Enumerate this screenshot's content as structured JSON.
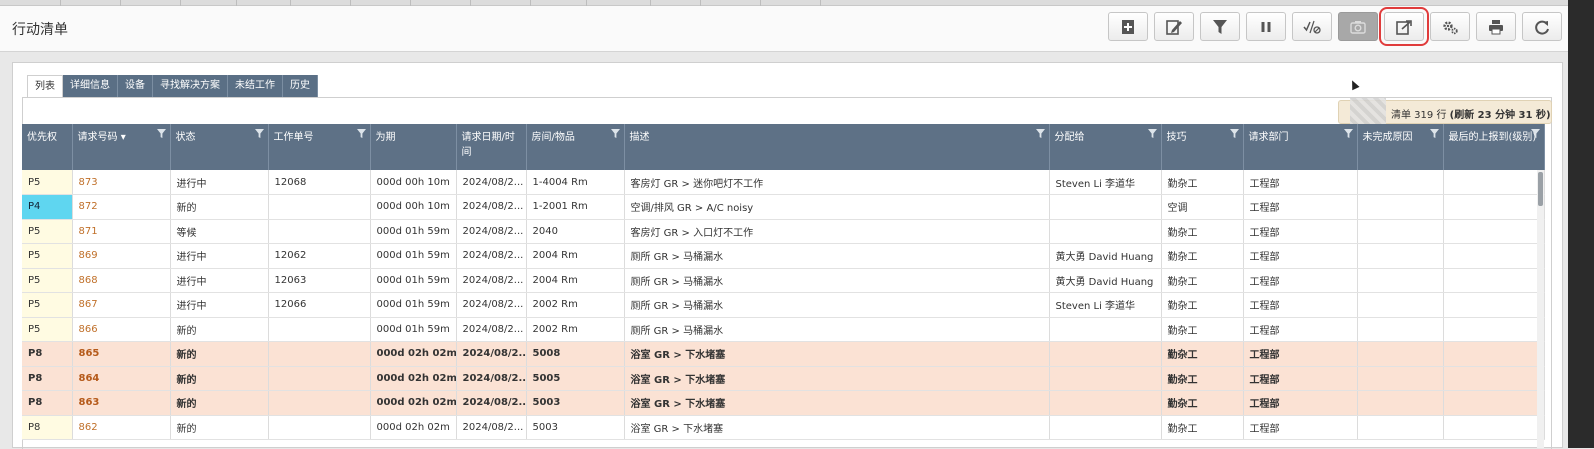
{
  "page": {
    "title": "行动清单"
  },
  "toolbar": {
    "buttons": [
      {
        "name": "add-button",
        "icon": "plus-icon"
      },
      {
        "name": "edit-button",
        "icon": "pencil-icon"
      },
      {
        "name": "filter-button",
        "icon": "filter-icon"
      },
      {
        "name": "pause-button",
        "icon": "pause-icon"
      },
      {
        "name": "complete-button",
        "icon": "check-slash-icon"
      },
      {
        "name": "camera-button",
        "icon": "camera-icon",
        "disabled": true
      },
      {
        "name": "export-button",
        "icon": "export-icon",
        "highlighted": true
      },
      {
        "name": "settings-button",
        "icon": "gear-icon"
      },
      {
        "name": "print-button",
        "icon": "printer-icon"
      },
      {
        "name": "refresh-button",
        "icon": "refresh-icon"
      }
    ]
  },
  "tabs": [
    "列表",
    "详细信息",
    "设备",
    "寻找解决方案",
    "未结工作",
    "历史"
  ],
  "status": {
    "text": "清单 319 行 ",
    "refresh": "(刷新 23 分钟 31 秒)"
  },
  "columns": [
    "优先权",
    "请求号码",
    "状态",
    "工作单号",
    "为期",
    "请求日期/时间",
    "房间/物品",
    "描述",
    "分配给",
    "技巧",
    "请求部门",
    "未完成原因",
    "最后的上报到(级别)"
  ],
  "rows": [
    {
      "priority": "P5",
      "request": "873",
      "status": "进行中",
      "work_order": "12068",
      "duration": "000d 00h 10m",
      "date": "2024/08/2...",
      "room": "1-4004 Rm",
      "description": "客房灯 GR > 迷你吧灯不工作",
      "assigned": "Steven Li 李道华",
      "skill": "勤杂工",
      "dept": "工程部",
      "reason": "",
      "escalation": ""
    },
    {
      "priority": "P4",
      "request": "872",
      "status": "新的",
      "work_order": "",
      "duration": "000d 00h 10m",
      "date": "2024/08/2...",
      "room": "1-2001 Rm",
      "description": "空调/排风 GR > A/C noisy",
      "assigned": "",
      "skill": "空调",
      "dept": "工程部",
      "reason": "",
      "escalation": ""
    },
    {
      "priority": "P5",
      "request": "871",
      "status": "等候",
      "work_order": "",
      "duration": "000d 01h 59m",
      "date": "2024/08/2...",
      "room": "2040",
      "description": "客房灯 GR > 入口灯不工作",
      "assigned": "",
      "skill": "勤杂工",
      "dept": "工程部",
      "reason": "",
      "escalation": ""
    },
    {
      "priority": "P5",
      "request": "869",
      "status": "进行中",
      "work_order": "12062",
      "duration": "000d 01h 59m",
      "date": "2024/08/2...",
      "room": "2004 Rm",
      "description": "厕所 GR > 马桶漏水",
      "assigned": "黄大勇 David Huang",
      "skill": "勤杂工",
      "dept": "工程部",
      "reason": "",
      "escalation": ""
    },
    {
      "priority": "P5",
      "request": "868",
      "status": "进行中",
      "work_order": "12063",
      "duration": "000d 01h 59m",
      "date": "2024/08/2...",
      "room": "2004 Rm",
      "description": "厕所 GR > 马桶漏水",
      "assigned": "黄大勇 David Huang",
      "skill": "勤杂工",
      "dept": "工程部",
      "reason": "",
      "escalation": ""
    },
    {
      "priority": "P5",
      "request": "867",
      "status": "进行中",
      "work_order": "12066",
      "duration": "000d 01h 59m",
      "date": "2024/08/2...",
      "room": "2002 Rm",
      "description": "厕所 GR > 马桶漏水",
      "assigned": "Steven Li 李道华",
      "skill": "勤杂工",
      "dept": "工程部",
      "reason": "",
      "escalation": ""
    },
    {
      "priority": "P5",
      "request": "866",
      "status": "新的",
      "work_order": "",
      "duration": "000d 01h 59m",
      "date": "2024/08/2...",
      "room": "2002 Rm",
      "description": "厕所 GR > 马桶漏水",
      "assigned": "",
      "skill": "勤杂工",
      "dept": "工程部",
      "reason": "",
      "escalation": ""
    },
    {
      "priority": "P8",
      "request": "865",
      "status": "新的",
      "work_order": "",
      "duration": "000d 02h 02m",
      "date": "2024/08/2...",
      "room": "5008",
      "description": "浴室 GR > 下水堵塞",
      "assigned": "",
      "skill": "勤杂工",
      "dept": "工程部",
      "reason": "",
      "escalation": "",
      "highlight": true
    },
    {
      "priority": "P8",
      "request": "864",
      "status": "新的",
      "work_order": "",
      "duration": "000d 02h 02m",
      "date": "2024/08/2...",
      "room": "5005",
      "description": "浴室 GR > 下水堵塞",
      "assigned": "",
      "skill": "勤杂工",
      "dept": "工程部",
      "reason": "",
      "escalation": "",
      "highlight": true
    },
    {
      "priority": "P8",
      "request": "863",
      "status": "新的",
      "work_order": "",
      "duration": "000d 02h 02m",
      "date": "2024/08/2...",
      "room": "5003",
      "description": "浴室 GR > 下水堵塞",
      "assigned": "",
      "skill": "勤杂工",
      "dept": "工程部",
      "reason": "",
      "escalation": "",
      "highlight": true
    },
    {
      "priority": "P8",
      "request": "862",
      "status": "新的",
      "work_order": "",
      "duration": "000d 02h 02m",
      "date": "2024/08/2...",
      "room": "5003",
      "description": "浴室 GR > 下水堵塞",
      "assigned": "",
      "skill": "勤杂工",
      "dept": "工程部",
      "reason": "",
      "escalation": ""
    }
  ],
  "colors": {
    "header": "#5e7186",
    "highlight_row": "#fbe2d4",
    "p4": "#5fd6f0",
    "request_link": "#c0702a",
    "toolbar_focus": "#e03c3c"
  }
}
